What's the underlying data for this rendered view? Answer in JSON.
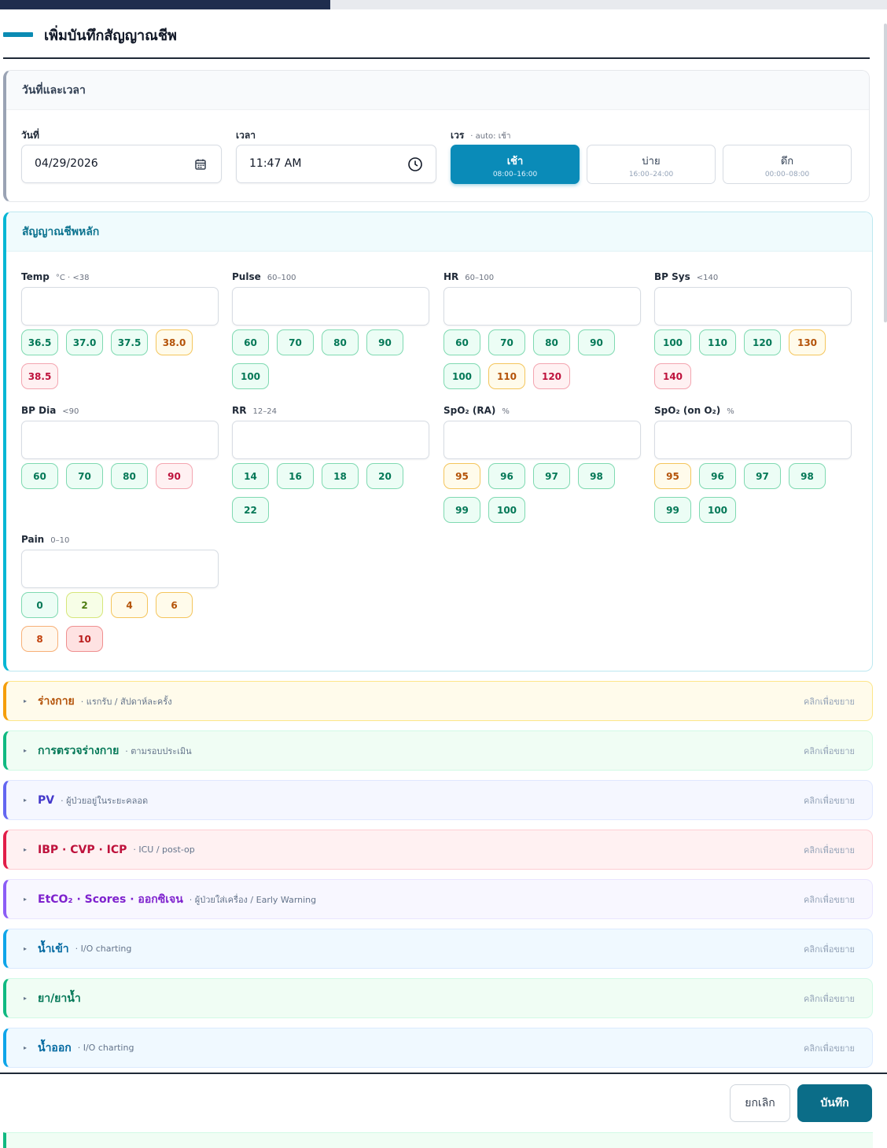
{
  "header": {
    "title": "เพิ่มบันทึกสัญญาณชีพ"
  },
  "datetime": {
    "section_title": "วันที่และเวลา",
    "date_label": "วันที่",
    "date_value": "04/29/2026",
    "time_label": "เวลา",
    "time_value": "11:47 AM",
    "shift_label": "เวร",
    "shift_hint": "· auto: เช้า",
    "shifts": [
      {
        "name": "เช้า",
        "time": "08:00–16:00",
        "active": true
      },
      {
        "name": "บ่าย",
        "time": "16:00–24:00",
        "active": false
      },
      {
        "name": "ดึก",
        "time": "00:00–08:00",
        "active": false
      }
    ]
  },
  "vitals": {
    "section_title": "สัญญาณชีพหลัก",
    "fields": [
      {
        "label": "Temp",
        "hint": "°C · <38",
        "chips": [
          {
            "v": "36.5",
            "s": "ok"
          },
          {
            "v": "37.0",
            "s": "ok"
          },
          {
            "v": "37.5",
            "s": "ok"
          },
          {
            "v": "38.0",
            "s": "warn"
          },
          {
            "v": "38.5",
            "s": "danger"
          }
        ]
      },
      {
        "label": "Pulse",
        "hint": "60–100",
        "chips": [
          {
            "v": "60",
            "s": "ok"
          },
          {
            "v": "70",
            "s": "ok"
          },
          {
            "v": "80",
            "s": "ok"
          },
          {
            "v": "90",
            "s": "ok"
          },
          {
            "v": "100",
            "s": "ok"
          }
        ]
      },
      {
        "label": "HR",
        "hint": "60–100",
        "chips": [
          {
            "v": "60",
            "s": "ok"
          },
          {
            "v": "70",
            "s": "ok"
          },
          {
            "v": "80",
            "s": "ok"
          },
          {
            "v": "90",
            "s": "ok"
          },
          {
            "v": "100",
            "s": "ok"
          },
          {
            "v": "110",
            "s": "warn"
          },
          {
            "v": "120",
            "s": "danger"
          }
        ]
      },
      {
        "label": "BP Sys",
        "hint": "<140",
        "chips": [
          {
            "v": "100",
            "s": "ok"
          },
          {
            "v": "110",
            "s": "ok"
          },
          {
            "v": "120",
            "s": "ok"
          },
          {
            "v": "130",
            "s": "warn"
          },
          {
            "v": "140",
            "s": "danger"
          }
        ]
      },
      {
        "label": "BP Dia",
        "hint": "<90",
        "chips": [
          {
            "v": "60",
            "s": "ok"
          },
          {
            "v": "70",
            "s": "ok"
          },
          {
            "v": "80",
            "s": "ok"
          },
          {
            "v": "90",
            "s": "danger"
          }
        ]
      },
      {
        "label": "RR",
        "hint": "12–24",
        "chips": [
          {
            "v": "14",
            "s": "ok"
          },
          {
            "v": "16",
            "s": "ok"
          },
          {
            "v": "18",
            "s": "ok"
          },
          {
            "v": "20",
            "s": "ok"
          },
          {
            "v": "22",
            "s": "ok"
          }
        ]
      },
      {
        "label": "SpO₂ (RA)",
        "hint": "%",
        "chips": [
          {
            "v": "95",
            "s": "warn"
          },
          {
            "v": "96",
            "s": "ok"
          },
          {
            "v": "97",
            "s": "ok"
          },
          {
            "v": "98",
            "s": "ok"
          },
          {
            "v": "99",
            "s": "ok"
          },
          {
            "v": "100",
            "s": "ok"
          }
        ]
      },
      {
        "label": "SpO₂ (on O₂)",
        "hint": "%",
        "chips": [
          {
            "v": "95",
            "s": "warn"
          },
          {
            "v": "96",
            "s": "ok"
          },
          {
            "v": "97",
            "s": "ok"
          },
          {
            "v": "98",
            "s": "ok"
          },
          {
            "v": "99",
            "s": "ok"
          },
          {
            "v": "100",
            "s": "ok"
          }
        ]
      },
      {
        "label": "Pain",
        "hint": "0–10",
        "chips": [
          {
            "v": "0",
            "s": "ok"
          },
          {
            "v": "2",
            "s": "mild"
          },
          {
            "v": "4",
            "s": "warn"
          },
          {
            "v": "6",
            "s": "warn"
          },
          {
            "v": "8",
            "s": "orange"
          },
          {
            "v": "10",
            "s": "red"
          }
        ]
      }
    ]
  },
  "sections": [
    {
      "name": "ร่างกาย",
      "sub": "· แรกรับ / สัปดาห์ละครั้ง",
      "more": "คลิกเพื่อขยาย",
      "color": "#f59e0b",
      "text_color": "#b45309",
      "bg": "#fffbeb",
      "border": "#fde68a"
    },
    {
      "name": "การตรวจร่างกาย",
      "sub": "· ตามรอบประเมิน",
      "more": "คลิกเพื่อขยาย",
      "color": "#10b981",
      "text_color": "#047857",
      "bg": "#f0fdf4",
      "border": "#d1fae5"
    },
    {
      "name": "PV",
      "sub": "· ผู้ป่วยอยู่ในระยะคลอด",
      "more": "คลิกเพื่อขยาย",
      "color": "#6366f1",
      "text_color": "#4338ca",
      "bg": "#f5f7ff",
      "border": "#e0e7ff"
    },
    {
      "name": "IBP · CVP · ICP",
      "sub": "· ICU / post-op",
      "more": "คลิกเพื่อขยาย",
      "color": "#e11d48",
      "text_color": "#be123c",
      "bg": "#fff1f2",
      "border": "#fecdd3"
    },
    {
      "name": "EtCO₂ · Scores · ออกซิเจน",
      "sub": "· ผู้ป่วยใส่เครื่อง / Early Warning",
      "more": "คลิกเพื่อขยาย",
      "color": "#8b5cf6",
      "text_color": "#7e22ce",
      "bg": "#f8f7ff",
      "border": "#e9e5ff"
    },
    {
      "name": "น้ำเข้า",
      "sub": "· I/O charting",
      "more": "คลิกเพื่อขยาย",
      "color": "#0ea5e9",
      "text_color": "#0369a1",
      "bg": "#f0f9ff",
      "border": "#dbeafe"
    },
    {
      "name": "ยา/ยาน้ำ",
      "sub": "",
      "more": "คลิกเพื่อขยาย",
      "color": "#10b981",
      "text_color": "#047857",
      "bg": "#f0fdf4",
      "border": "#d1fae5"
    },
    {
      "name": "น้ำออก",
      "sub": "· I/O charting",
      "more": "คลิกเพื่อขยาย",
      "color": "#0ea5e9",
      "text_color": "#0369a1",
      "bg": "#f0f9ff",
      "border": "#dbeafe"
    }
  ],
  "footer": {
    "cancel": "ยกเลิก",
    "save": "บันทึก"
  },
  "icons": {
    "date": "calendar-icon",
    "time": "clock-icon",
    "section": "caret-right-icon"
  }
}
